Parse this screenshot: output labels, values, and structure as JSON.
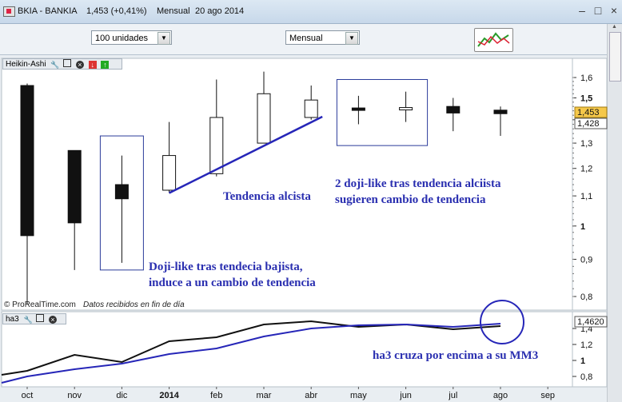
{
  "window": {
    "symbol": "BKIA - BANKIA",
    "price": "1,453 (+0,41%)",
    "period": "Mensual",
    "date": "20 ago 2014"
  },
  "toolbar": {
    "units_select": "100 unidades",
    "period_select": "Mensual"
  },
  "price_pane": {
    "name": "Heikin-Ashi",
    "watermark": "© ProRealTime.com",
    "watermark_note": "Datos recibidos en fin de día"
  },
  "indicator_pane": {
    "name": "ha3",
    "badge": "1,4620"
  },
  "colors": {
    "annotation": "#2a2fb0",
    "bearish": "#111111",
    "bullish": "#ffffff",
    "indicator": "#111111",
    "signal": "#2626b8",
    "last_price": "#f5c84a"
  },
  "chart_data": [
    {
      "type": "candlestick",
      "title": "Heikin-Ashi",
      "x_ticks": [
        "oct",
        "nov",
        "dic",
        "2014",
        "feb",
        "mar",
        "abr",
        "may",
        "jun",
        "jul",
        "ago",
        "sep"
      ],
      "y_ticks": [
        "1,6",
        "1,5",
        "1,4",
        "1,3",
        "1,2",
        "1,1",
        "1",
        "0,9",
        "0,8"
      ],
      "ylim": [
        0.77,
        1.65
      ],
      "scale": "log",
      "grid": false,
      "candles": [
        {
          "x": "oct",
          "open": 1.56,
          "close": 0.97,
          "high": 1.57,
          "low": 0.78
        },
        {
          "x": "nov",
          "open": 1.27,
          "close": 1.01,
          "high": 1.27,
          "low": 0.87
        },
        {
          "x": "dic",
          "open": 1.14,
          "close": 1.09,
          "high": 1.25,
          "low": 0.89
        },
        {
          "x": "2014",
          "open": 1.12,
          "close": 1.25,
          "high": 1.39,
          "low": 1.11
        },
        {
          "x": "feb",
          "open": 1.18,
          "close": 1.41,
          "high": 1.59,
          "low": 1.17
        },
        {
          "x": "mar",
          "open": 1.3,
          "close": 1.52,
          "high": 1.63,
          "low": 1.3
        },
        {
          "x": "abr",
          "open": 1.41,
          "close": 1.49,
          "high": 1.56,
          "low": 1.4
        },
        {
          "x": "may",
          "open": 1.45,
          "close": 1.445,
          "high": 1.51,
          "low": 1.38
        },
        {
          "x": "jun",
          "open": 1.447,
          "close": 1.452,
          "high": 1.53,
          "low": 1.39
        },
        {
          "x": "jul",
          "open": 1.46,
          "close": 1.43,
          "high": 1.5,
          "low": 1.35
        },
        {
          "x": "ago",
          "open": 1.443,
          "close": 1.427,
          "high": 1.46,
          "low": 1.33
        }
      ],
      "price_labels": [
        "1,453",
        "1,428"
      ],
      "annotations": [
        {
          "text": "Tendencia alcista"
        },
        {
          "text": "2 doji-like tras tendencia alciista"
        },
        {
          "text": "sugieren cambio de tendencia"
        },
        {
          "text": "Doji-like tras tendecia bajista,"
        },
        {
          "text": "induce a un cambio de tendencia"
        }
      ],
      "trendline": {
        "from": {
          "x": "2014",
          "y": 1.11
        },
        "to": {
          "x": "abr",
          "y": 1.41
        }
      },
      "highlight_boxes": [
        {
          "from": "dic",
          "to": "dic",
          "ylow": 0.87,
          "yhigh": 1.33
        },
        {
          "from": "may",
          "to": "jun",
          "ylow": 1.29,
          "yhigh": 1.59
        }
      ]
    },
    {
      "type": "line",
      "title": "ha3",
      "x": [
        "oct",
        "nov",
        "dic",
        "2014",
        "feb",
        "mar",
        "abr",
        "may",
        "jun",
        "jul",
        "ago"
      ],
      "y_ticks": [
        "1,4",
        "1,2",
        "1",
        "0,8"
      ],
      "ylim": [
        0.73,
        1.53
      ],
      "series": [
        {
          "values": [
            0.82,
            0.87,
            1.07,
            0.98,
            1.24,
            1.29,
            1.45,
            1.49,
            1.42,
            1.45,
            1.39,
            1.43
          ]
        },
        {
          "values": [
            0.72,
            0.8,
            0.89,
            0.96,
            1.08,
            1.15,
            1.3,
            1.4,
            1.44,
            1.45,
            1.42,
            1.46
          ]
        }
      ],
      "annotations": [
        {
          "text": "ha3 cruza por encima a su MM3"
        }
      ]
    }
  ]
}
